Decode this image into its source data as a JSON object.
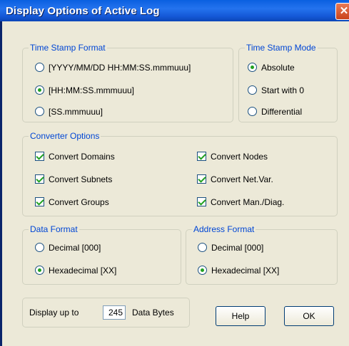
{
  "window": {
    "title": "Display Options of Active Log",
    "close_glyph": "✕"
  },
  "time_stamp_format": {
    "legend": "Time Stamp Format",
    "options": [
      "[YYYY/MM/DD HH:MM:SS.mmmuuu]",
      "[HH:MM:SS.mmmuuu]",
      "[SS.mmmuuu]"
    ],
    "selected": 1
  },
  "time_stamp_mode": {
    "legend": "Time Stamp Mode",
    "options": [
      "Absolute",
      "Start with 0",
      "Differential"
    ],
    "selected": 0
  },
  "converter_options": {
    "legend": "Converter Options",
    "items": [
      {
        "label": "Convert Domains",
        "checked": true
      },
      {
        "label": "Convert Subnets",
        "checked": true
      },
      {
        "label": "Convert Groups",
        "checked": true
      },
      {
        "label": "Convert Nodes",
        "checked": true
      },
      {
        "label": "Convert Net.Var.",
        "checked": true
      },
      {
        "label": "Convert Man./Diag.",
        "checked": true
      }
    ]
  },
  "data_format": {
    "legend": "Data Format",
    "options": [
      "Decimal [000]",
      "Hexadecimal [XX]"
    ],
    "selected": 1
  },
  "address_format": {
    "legend": "Address Format",
    "options": [
      "Decimal [000]",
      "Hexadecimal [XX]"
    ],
    "selected": 1
  },
  "display_bytes": {
    "prefix": "Display up to",
    "value": "245",
    "suffix": "Data Bytes"
  },
  "buttons": {
    "help": "Help",
    "ok": "OK"
  },
  "icons": {
    "radio": "radio-button",
    "checkbox": "checkbox",
    "close": "close-icon"
  },
  "colors": {
    "title_bar": "#1559d8",
    "client": "#ece9d8",
    "group_legend": "#0046d5",
    "mark": "#21a121",
    "close_button": "#c9431b"
  }
}
